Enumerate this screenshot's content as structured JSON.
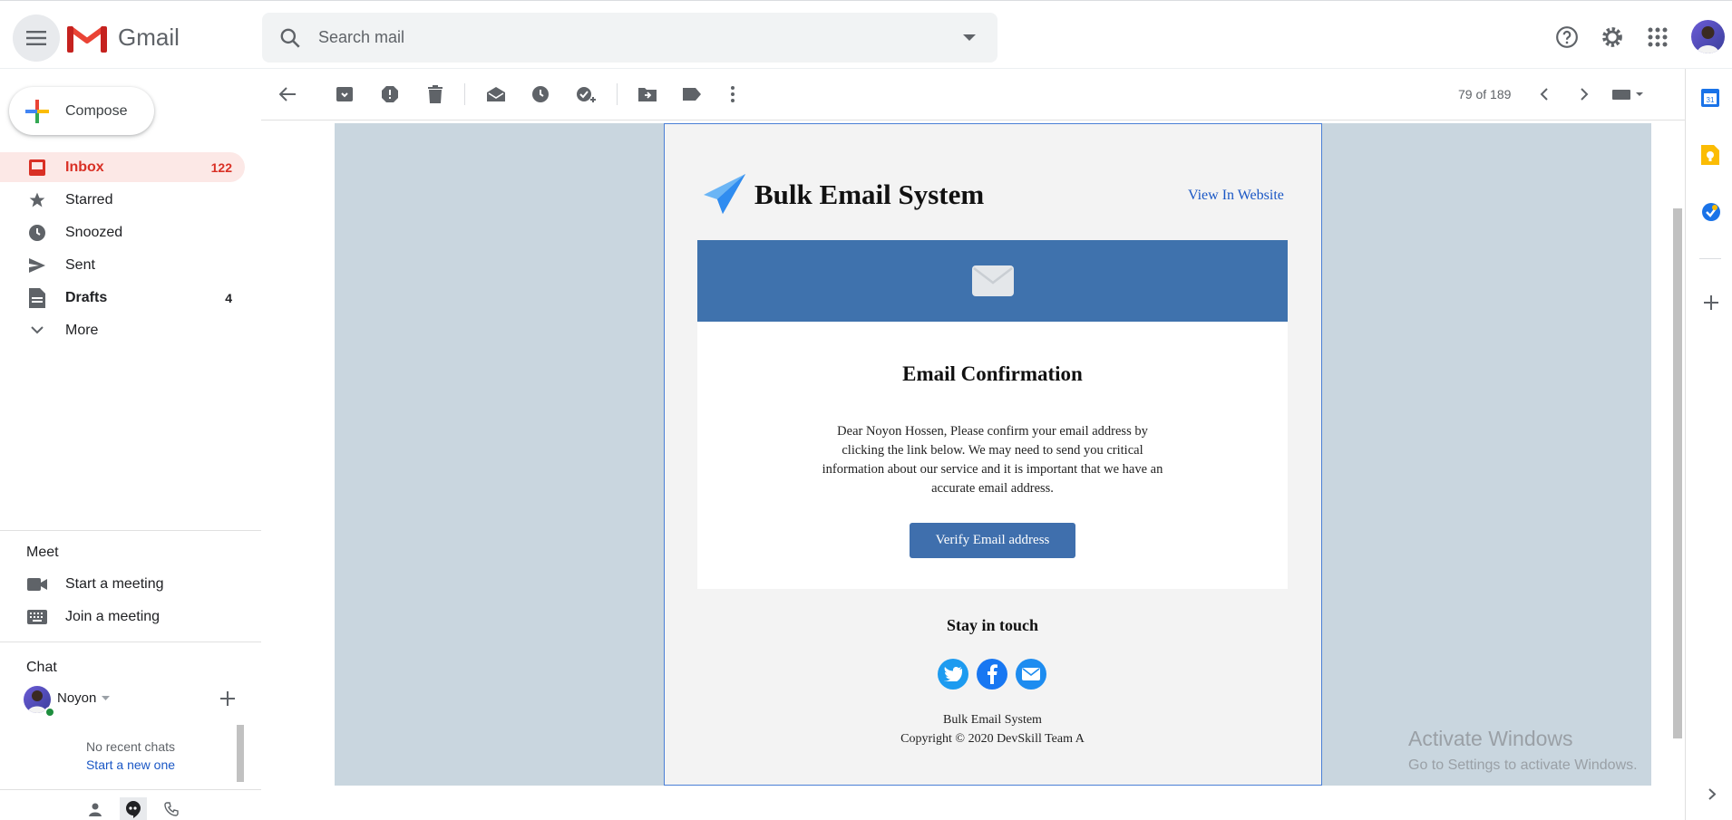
{
  "header": {
    "app_name": "Gmail",
    "search_placeholder": "Search mail"
  },
  "sidebar": {
    "compose_label": "Compose",
    "items": [
      {
        "label": "Inbox",
        "count": "122"
      },
      {
        "label": "Starred",
        "count": ""
      },
      {
        "label": "Snoozed",
        "count": ""
      },
      {
        "label": "Sent",
        "count": ""
      },
      {
        "label": "Drafts",
        "count": "4"
      },
      {
        "label": "More",
        "count": ""
      }
    ],
    "meet": {
      "title": "Meet",
      "start": "Start a meeting",
      "join": "Join a meeting"
    },
    "chat": {
      "title": "Chat",
      "user": "Noyon",
      "no_recent": "No recent chats",
      "start_new": "Start a new one"
    }
  },
  "toolbar": {
    "pagination": "79 of 189"
  },
  "email": {
    "brand": "Bulk Email System",
    "view_in_website": "View In Website",
    "heading": "Email Confirmation",
    "body_lines": [
      "Dear Noyon Hossen, Please confirm your email address by",
      "clicking the link below. We may need to send you critical",
      "information about our service and it is important that we have an",
      "accurate email address."
    ],
    "button": "Verify Email address",
    "stay_in_touch": "Stay in touch",
    "footer_name": "Bulk Email System",
    "copyright": "Copyright © 2020 DevSkill Team A"
  },
  "watermark": {
    "title": "Activate Windows",
    "subtitle": "Go to Settings to activate Windows."
  },
  "colors": {
    "inbox_active_bg": "#fce8e6",
    "inbox_active_text": "#d93025",
    "banner": "#3f72ad",
    "email_backdrop": "#c9d6df",
    "link": "#1a57c5"
  }
}
